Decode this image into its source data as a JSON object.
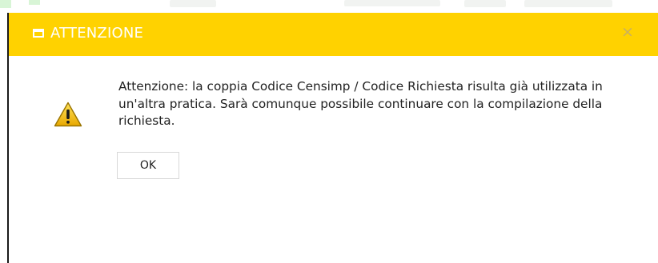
{
  "dialog": {
    "title": "ATTENZIONE",
    "title_icon": "window-icon",
    "close_label": "×",
    "warning_icon": "warning-triangle-icon",
    "message": "Attenzione: la coppia Codice Censimp / Codice Richiesta risulta già utilizzata in un'altra pratica. Sarà comunque possibile continuare con la compilazione della richiesta.",
    "ok_label": "OK"
  },
  "colors": {
    "titlebar": "#ffd200",
    "title_text": "#ffffff",
    "warning_fill": "#f2c200",
    "warning_outline": "#9a7400"
  }
}
